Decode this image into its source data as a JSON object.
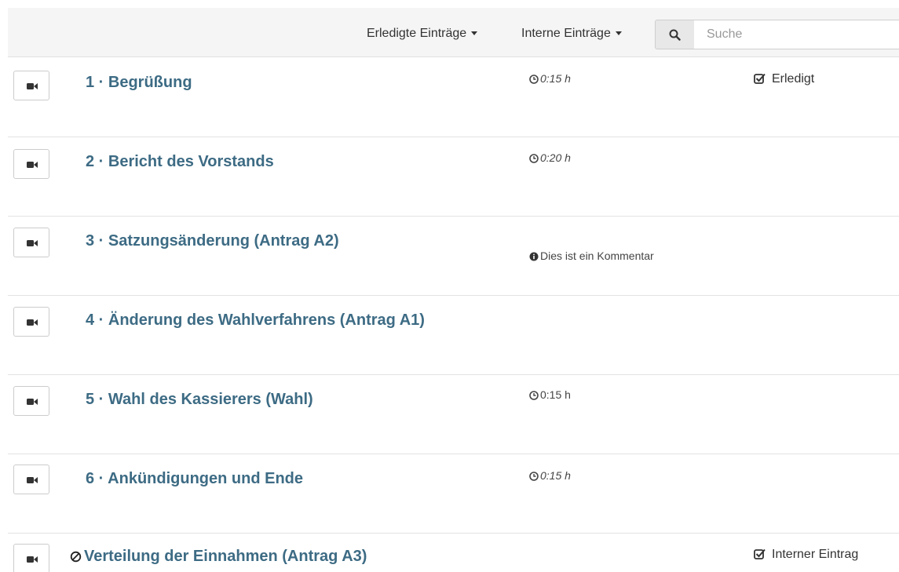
{
  "toolbar": {
    "filter_done_label": "Erledigte Einträge",
    "filter_internal_label": "Interne Einträge",
    "search_placeholder": "Suche",
    "search_value": ""
  },
  "items": [
    {
      "title": "1 · Begrüßung",
      "duration": "0:15 h",
      "status": "Erledigt"
    },
    {
      "title": "2 · Bericht des Vorstands",
      "duration": "0:20 h"
    },
    {
      "title": "3 · Satzungsänderung (Antrag A2)",
      "comment": "Dies ist ein Kommentar"
    },
    {
      "title": "4 · Änderung des Wahlverfahrens (Antrag A1)"
    },
    {
      "title": "5 · Wahl des Kassierers (Wahl)",
      "duration": "0:15 h"
    },
    {
      "title": "6 · Ankündigungen und Ende",
      "duration": "0:15 h"
    },
    {
      "title": "Verteilung der Einnahmen (Antrag A3)",
      "status": "Interner Eintrag"
    }
  ],
  "colors": {
    "title_link": "#3d6b84",
    "toolbar_bg": "#f5f5f5",
    "divider": "#e3e3e3"
  }
}
